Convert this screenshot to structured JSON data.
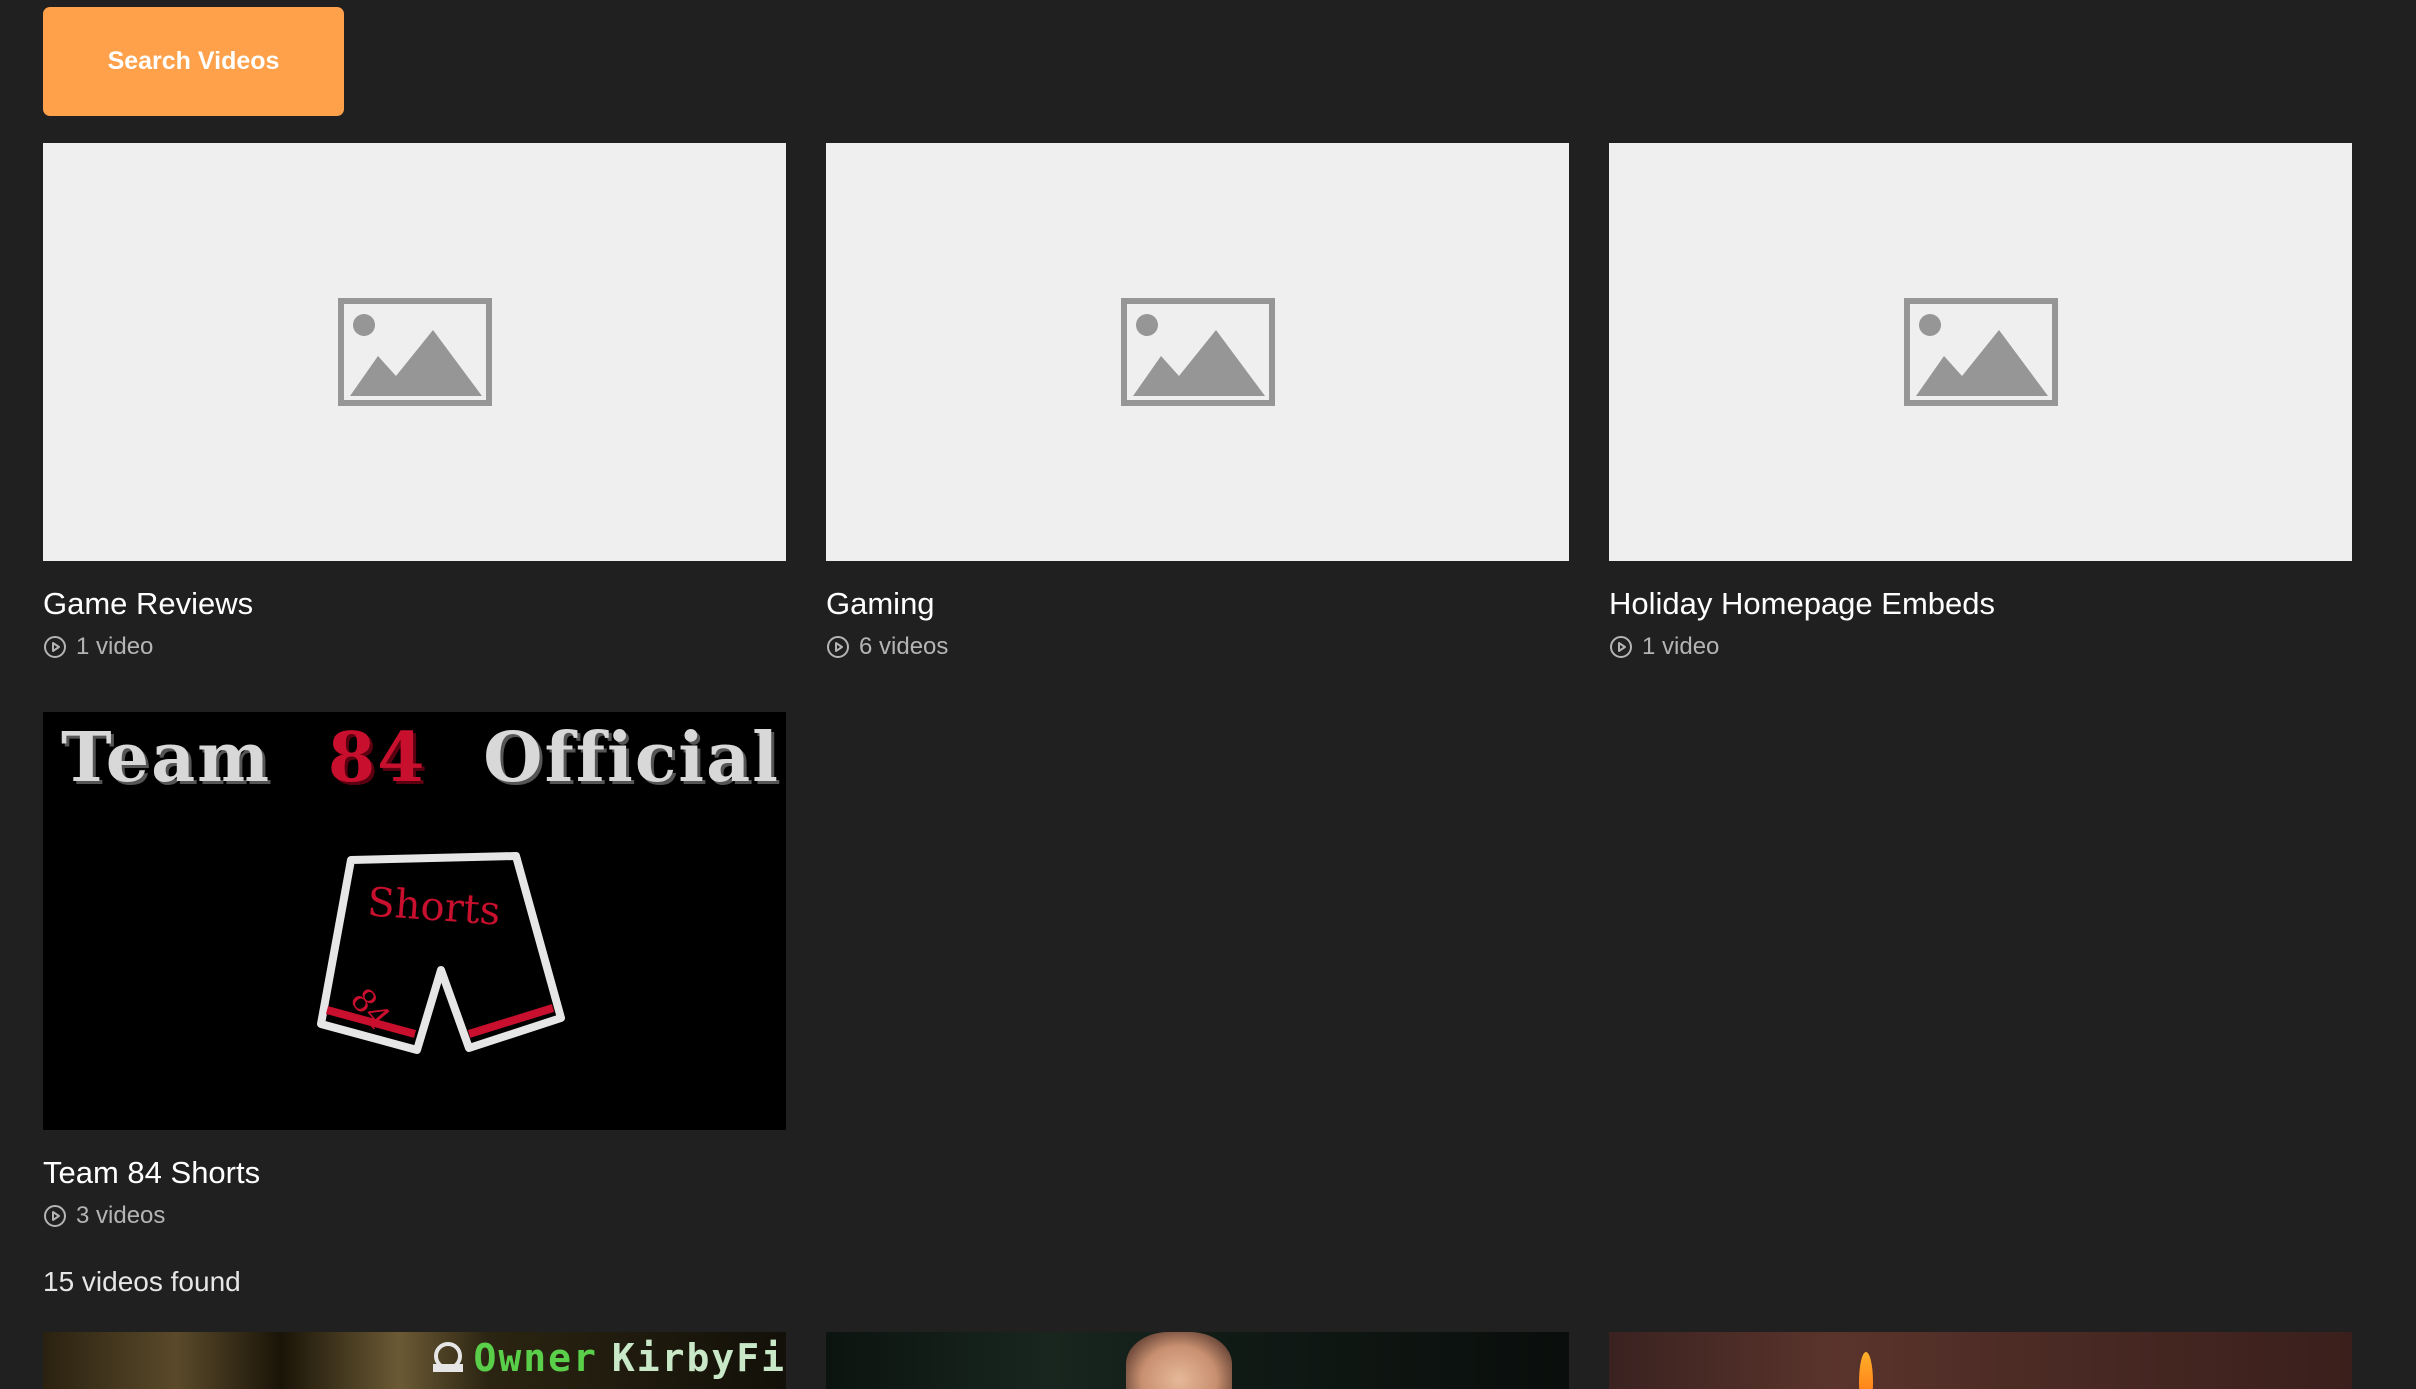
{
  "toolbar": {
    "search_label": "Search Videos",
    "accent_color": "#ffa04a"
  },
  "playlists": [
    {
      "title": "Game Reviews",
      "count": "1 video",
      "thumbnail": "placeholder-image-icon"
    },
    {
      "title": "Gaming",
      "count": "6 videos",
      "thumbnail": "placeholder-image-icon"
    },
    {
      "title": "Holiday Homepage Embeds",
      "count": "1 video",
      "thumbnail": "placeholder-image-icon"
    },
    {
      "title": "Team 84 Shorts",
      "count": "3 videos",
      "thumbnail": "team-84-shorts-art",
      "thumb_text": {
        "word1": "Team",
        "number": "84",
        "word2": "Official",
        "shorts_label": "Shorts",
        "leg_number": "84"
      }
    }
  ],
  "results": {
    "found_text": "15 videos found"
  },
  "videos": [
    {
      "overlay_owner": "Owner",
      "overlay_name": "KirbyFi"
    },
    {},
    {}
  ]
}
